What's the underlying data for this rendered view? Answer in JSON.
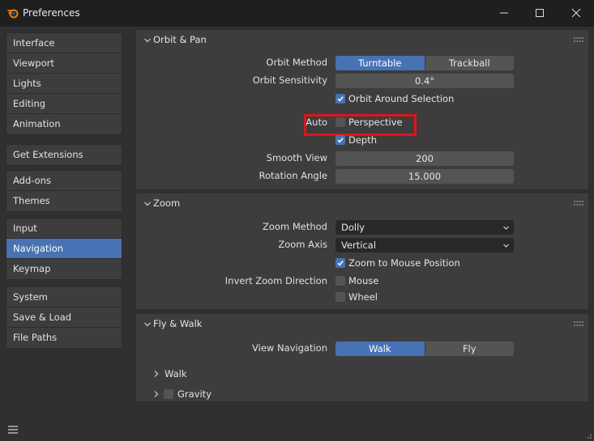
{
  "window": {
    "title": "Preferences"
  },
  "sidebar": {
    "groups": [
      [
        "Interface",
        "Viewport",
        "Lights",
        "Editing",
        "Animation"
      ],
      [
        "Get Extensions"
      ],
      [
        "Add-ons",
        "Themes"
      ],
      [
        "Input",
        "Navigation",
        "Keymap"
      ],
      [
        "System",
        "Save & Load",
        "File Paths"
      ]
    ],
    "active": "Navigation"
  },
  "orbit_pan": {
    "title": "Orbit & Pan",
    "orbit_method_label": "Orbit Method",
    "orbit_method_options": [
      "Turntable",
      "Trackball"
    ],
    "orbit_method_selected": "Turntable",
    "orbit_sensitivity_label": "Orbit Sensitivity",
    "orbit_sensitivity_value": "0.4°",
    "orbit_around_selection": {
      "label": "Orbit Around Selection",
      "checked": true
    },
    "auto_label": "Auto",
    "perspective": {
      "label": "Perspective",
      "checked": false
    },
    "depth": {
      "label": "Depth",
      "checked": true
    },
    "smooth_view_label": "Smooth View",
    "smooth_view_value": "200",
    "rotation_angle_label": "Rotation Angle",
    "rotation_angle_value": "15.000"
  },
  "zoom": {
    "title": "Zoom",
    "zoom_method_label": "Zoom Method",
    "zoom_method_value": "Dolly",
    "zoom_axis_label": "Zoom Axis",
    "zoom_axis_value": "Vertical",
    "zoom_to_mouse": {
      "label": "Zoom to Mouse Position",
      "checked": true
    },
    "invert_label": "Invert Zoom Direction",
    "mouse": {
      "label": "Mouse",
      "checked": false
    },
    "wheel": {
      "label": "Wheel",
      "checked": false
    }
  },
  "fly_walk": {
    "title": "Fly & Walk",
    "view_navigation_label": "View Navigation",
    "view_navigation_options": [
      "Walk",
      "Fly"
    ],
    "view_navigation_selected": "Walk",
    "walk_label": "Walk",
    "gravity": {
      "label": "Gravity",
      "checked": false
    }
  },
  "colors": {
    "accent": "#4772b3",
    "highlight": "#e0141c"
  }
}
